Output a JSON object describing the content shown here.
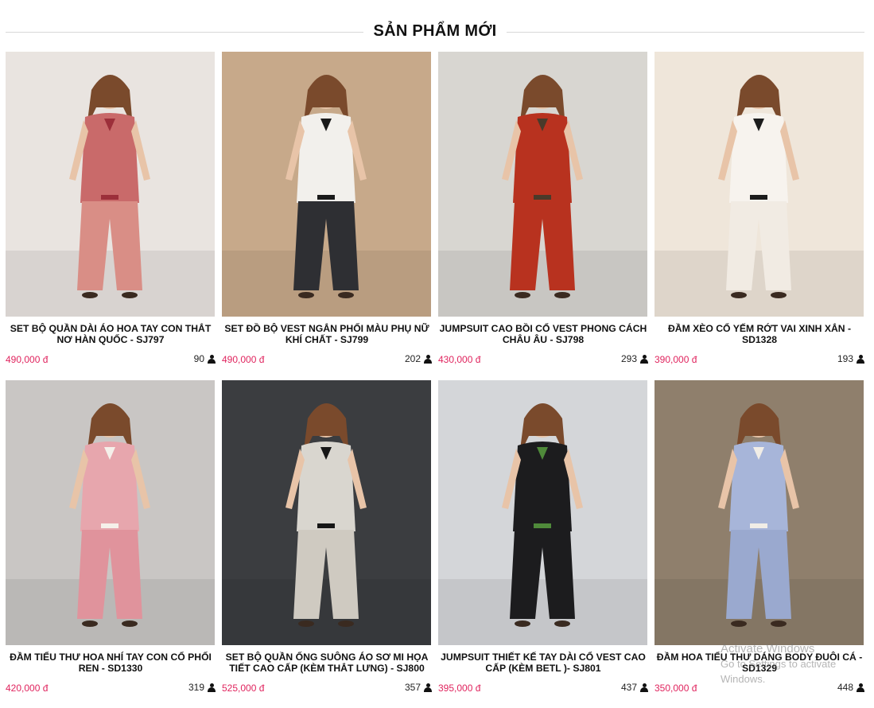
{
  "section": {
    "title": "SẢN PHẨM MỚI"
  },
  "products": [
    {
      "name": "SET BỘ QUẦN DÀI ÁO HOA TAY CON THẮT NƠ HÀN QUỐC - SJ797",
      "price": "490,000 đ",
      "count": "90",
      "colors": {
        "bg": "#e9e4e0",
        "top": "#c96a6a",
        "bottom": "#d98e86",
        "accent": "#9c2f3a"
      }
    },
    {
      "name": "SET ĐỒ BỘ VEST NGẮN PHỐI MÀU PHỤ NỮ KHÍ CHẤT - SJ799",
      "price": "490,000 đ",
      "count": "202",
      "colors": {
        "bg": "#c7a98a",
        "top": "#f2f0ec",
        "bottom": "#2e2f33",
        "accent": "#1a1a1a"
      }
    },
    {
      "name": "JUMPSUIT CAO BỒI CỔ VEST PHONG CÁCH CHÂU ÂU - SJ798",
      "price": "430,000 đ",
      "count": "293",
      "colors": {
        "bg": "#d8d6d1",
        "top": "#b8321f",
        "bottom": "#b8321f",
        "accent": "#4a3a2a"
      }
    },
    {
      "name": "ĐẦM XÈO CỔ YẾM RỚT VAI XINH XẮN - SD1328",
      "price": "390,000 đ",
      "count": "193",
      "colors": {
        "bg": "#efe6da",
        "top": "#f7f3ee",
        "bottom": "#f1ebe3",
        "accent": "#1c1c1c"
      }
    },
    {
      "name": "ĐẦM TIỂU THƯ HOA NHÍ TAY CON CỔ PHỐI REN - SD1330",
      "price": "420,000 đ",
      "count": "319",
      "colors": {
        "bg": "#c9c6c4",
        "top": "#e7a6ad",
        "bottom": "#e0939c",
        "accent": "#f5f0ea"
      }
    },
    {
      "name": "SET BỘ QUẦN ỐNG SUÔNG ÁO SƠ MI HỌA TIẾT CAO CẤP (KÈM THẮT LƯNG) - SJ800",
      "price": "525,000 đ",
      "count": "357",
      "colors": {
        "bg": "#3b3d40",
        "top": "#d9d6cf",
        "bottom": "#cfcac1",
        "accent": "#161616"
      }
    },
    {
      "name": "JUMPSUIT THIẾT KẾ TAY DÀI CỔ VEST CAO CẤP (KÈM BETL )- SJ801",
      "price": "395,000 đ",
      "count": "437",
      "colors": {
        "bg": "#d4d6d9",
        "top": "#1c1c1e",
        "bottom": "#1c1c1e",
        "accent": "#4f8a3a"
      }
    },
    {
      "name": "ĐẦM HOA TIỂU THƯ DÁNG BODY ĐUÔI CÁ - SD1329",
      "price": "350,000 đ",
      "count": "448",
      "colors": {
        "bg": "#8f7f6c",
        "top": "#a7b5d9",
        "bottom": "#9aa9cf",
        "accent": "#f1ede6"
      }
    }
  ],
  "watermark": {
    "line1": "Activate Windows",
    "line2": "Go to Settings to activate Windows."
  },
  "icons": {
    "views": "user-icon"
  }
}
